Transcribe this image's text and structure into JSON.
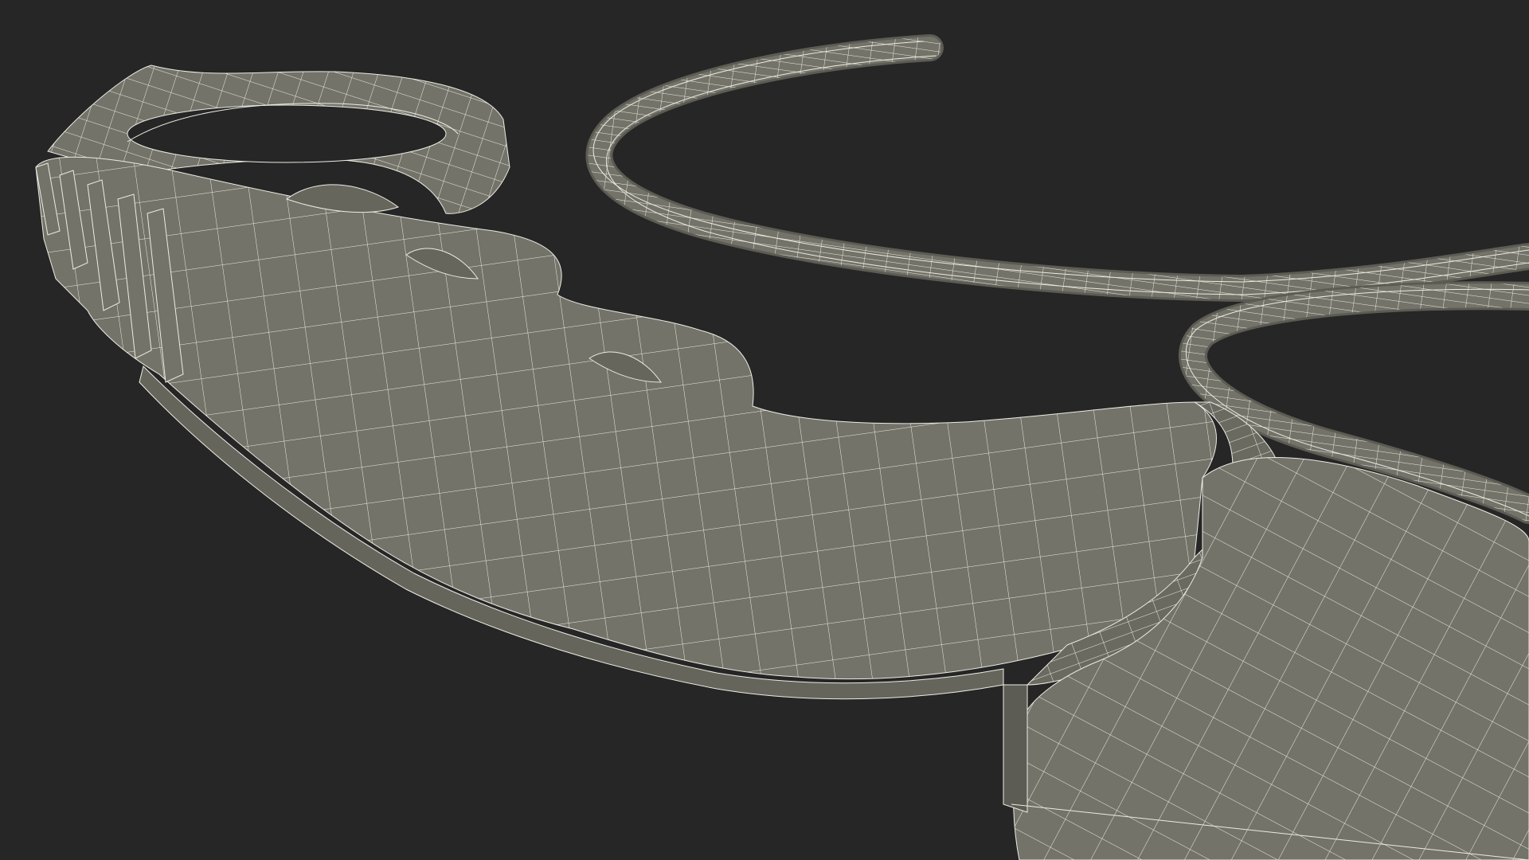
{
  "scene": {
    "object": "wireframe-3d-model",
    "background_color": "#262626",
    "mesh_fill_color": "#737369",
    "mesh_shadow_color": "#5c5c54",
    "wire_color": "#ecece4"
  }
}
